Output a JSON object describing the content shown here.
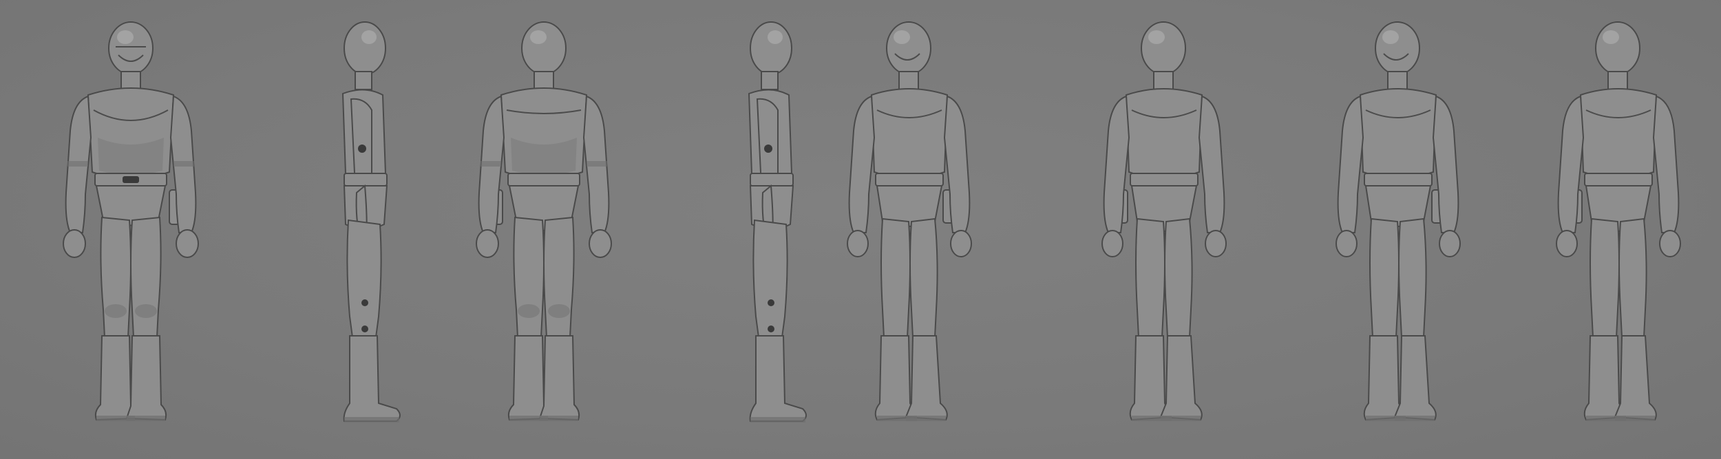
{
  "scene": {
    "background_color": "#7b7b7b",
    "model_color": "#8e8e8e",
    "figures": [
      {
        "view": "front"
      },
      {
        "view": "side"
      },
      {
        "view": "back"
      },
      {
        "view": "side"
      },
      {
        "view": "front-three-quarter"
      },
      {
        "view": "back-three-quarter"
      },
      {
        "view": "front-three-quarter"
      },
      {
        "view": "back-three-quarter"
      }
    ]
  }
}
